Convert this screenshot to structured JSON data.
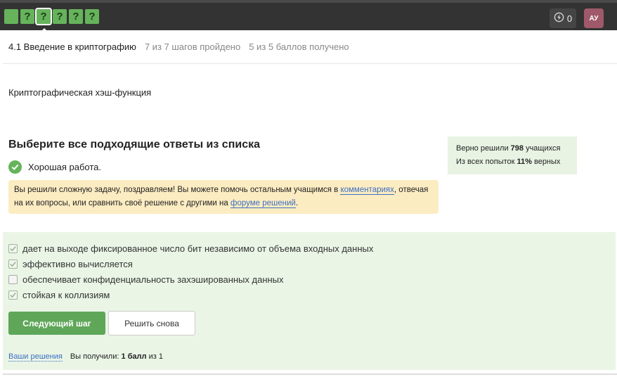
{
  "topbar": {
    "steps": [
      "",
      "?",
      "?",
      "?",
      "?",
      "?"
    ],
    "energy_count": "0",
    "avatar_initials": "АУ",
    "colors": {
      "step_green": "#66b35c",
      "avatar": "#a0596a"
    }
  },
  "lesson": {
    "title": "4.1 Введение в криптографию",
    "progress": "7 из 7 шагов пройдено",
    "score": "5 из 5 баллов  получено"
  },
  "step_name": "Криптографическая хэш-функция",
  "question": "Выберите все подходящие ответы из списка",
  "feedback": "Хорошая работа.",
  "notice": {
    "text_before": "Вы решили сложную задачу, поздравляем! Вы можете помочь остальным учащимся в ",
    "link_comments": "комментариях",
    "text_middle": ", отвечая на их вопросы, или сравнить своё решение с другими на ",
    "link_forum": "форуме решений",
    "text_after": "."
  },
  "stats": {
    "solved_prefix": "Верно решили ",
    "solved_count": "798",
    "solved_suffix": " учащихся",
    "attempts_prefix": "Из всех попыток ",
    "attempts_percent": "11%",
    "attempts_suffix": " верных"
  },
  "options": [
    {
      "label": "дает на выходе фиксированное число бит независимо от объема входных данных",
      "checked": true
    },
    {
      "label": "эффективно вычисляется",
      "checked": true
    },
    {
      "label": "обеспечивает конфиденциальность захэшированных данных",
      "checked": false
    },
    {
      "label": "стойкая к коллизиям",
      "checked": true
    }
  ],
  "buttons": {
    "next": "Следующий шаг",
    "retry": "Решить снова"
  },
  "footer": {
    "your_solutions": "Ваши решения",
    "received_prefix": "Вы получили: ",
    "received_value": "1 балл",
    "received_suffix": " из 1"
  }
}
